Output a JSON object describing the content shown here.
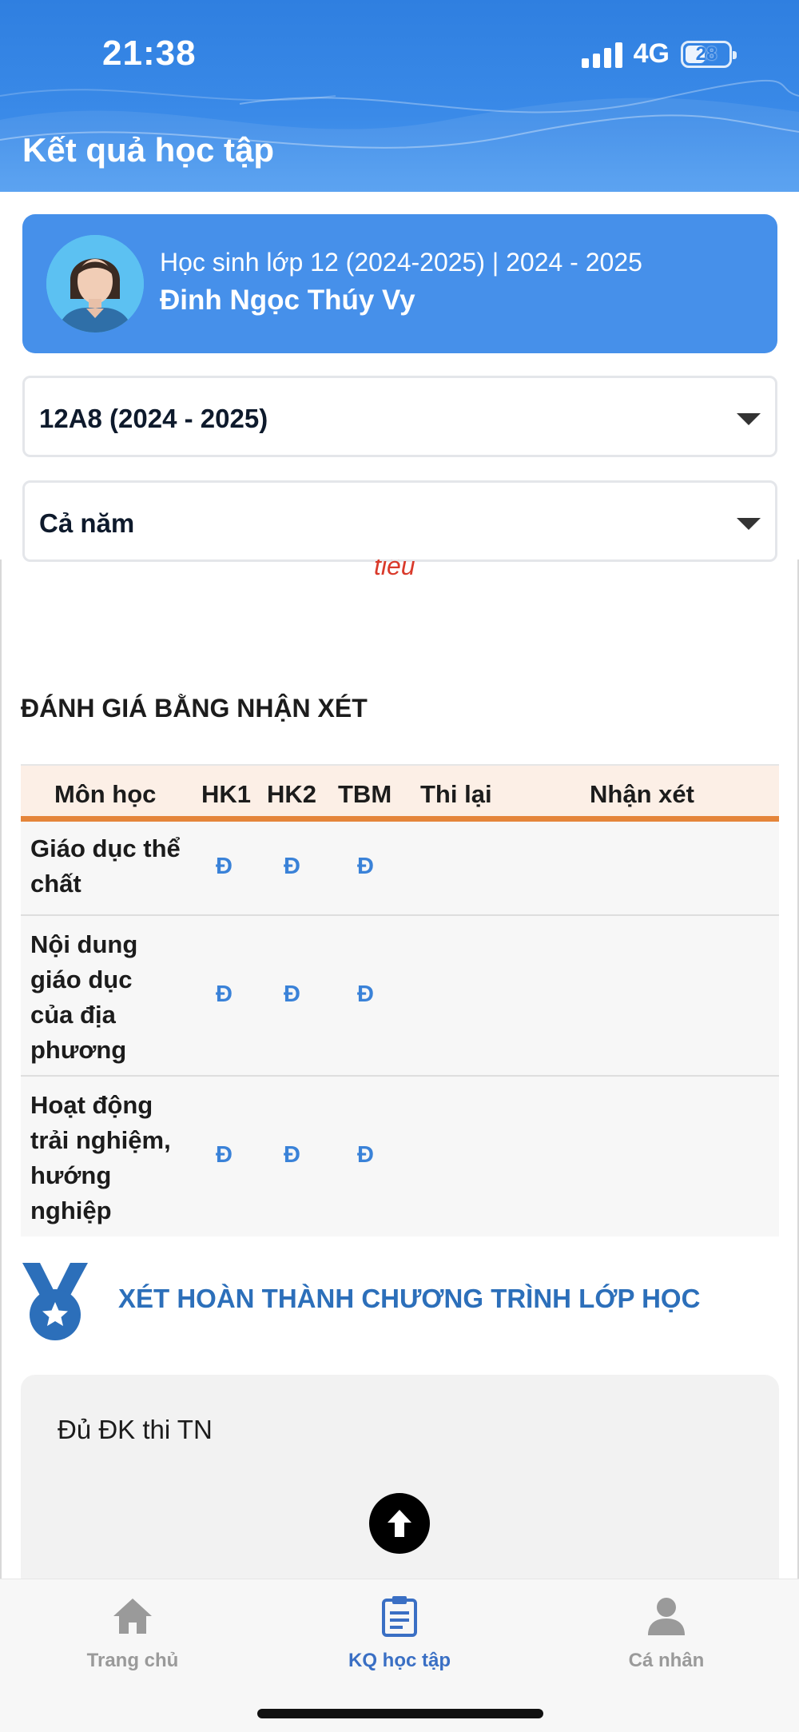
{
  "status_bar": {
    "time": "21:38",
    "network": "4G",
    "battery": "28"
  },
  "header": {
    "title": "Kết quả học tập"
  },
  "student": {
    "class_year": "Học sinh lớp 12 (2024-2025) | 2024 - 2025",
    "name": "Đinh Ngọc Thúy Vy"
  },
  "filters": {
    "class_select": "12A8 (2024 - 2025)",
    "term_select": "Cả năm"
  },
  "content": {
    "cut_text": "tiêu",
    "section_title": "ĐÁNH GIÁ BẰNG NHẬN XÉT",
    "table": {
      "headers": [
        "Môn học",
        "HK1",
        "HK2",
        "TBM",
        "Thi lại",
        "Nhận xét"
      ],
      "rows": [
        {
          "subject": "Giáo dục thể chất",
          "hk1": "Đ",
          "hk2": "Đ",
          "tbm": "Đ",
          "thi_lai": "",
          "nhan_xet": ""
        },
        {
          "subject": "Nội dung giáo dục của địa phương",
          "hk1": "Đ",
          "hk2": "Đ",
          "tbm": "Đ",
          "thi_lai": "",
          "nhan_xet": ""
        },
        {
          "subject": "Hoạt động trải nghiệm, hướng nghiệp",
          "hk1": "Đ",
          "hk2": "Đ",
          "tbm": "Đ",
          "thi_lai": "",
          "nhan_xet": ""
        }
      ]
    },
    "completion_title": "XÉT HOÀN THÀNH CHƯƠNG TRÌNH LỚP HỌC",
    "completion_result": "Đủ ĐK thi TN"
  },
  "bottom_nav": {
    "items": [
      {
        "label": "Trang chủ",
        "icon": "home-icon",
        "active": false
      },
      {
        "label": "KQ học tập",
        "icon": "clipboard-icon",
        "active": true
      },
      {
        "label": "Cá nhân",
        "icon": "person-icon",
        "active": false
      }
    ]
  },
  "colors": {
    "header": "#2f7fe0",
    "card": "#4690ea",
    "accent_orange": "#e5853a",
    "mark_blue": "#3a82d8",
    "nav_active": "#3a6fc4",
    "nav_inactive": "#9a9a9a"
  }
}
